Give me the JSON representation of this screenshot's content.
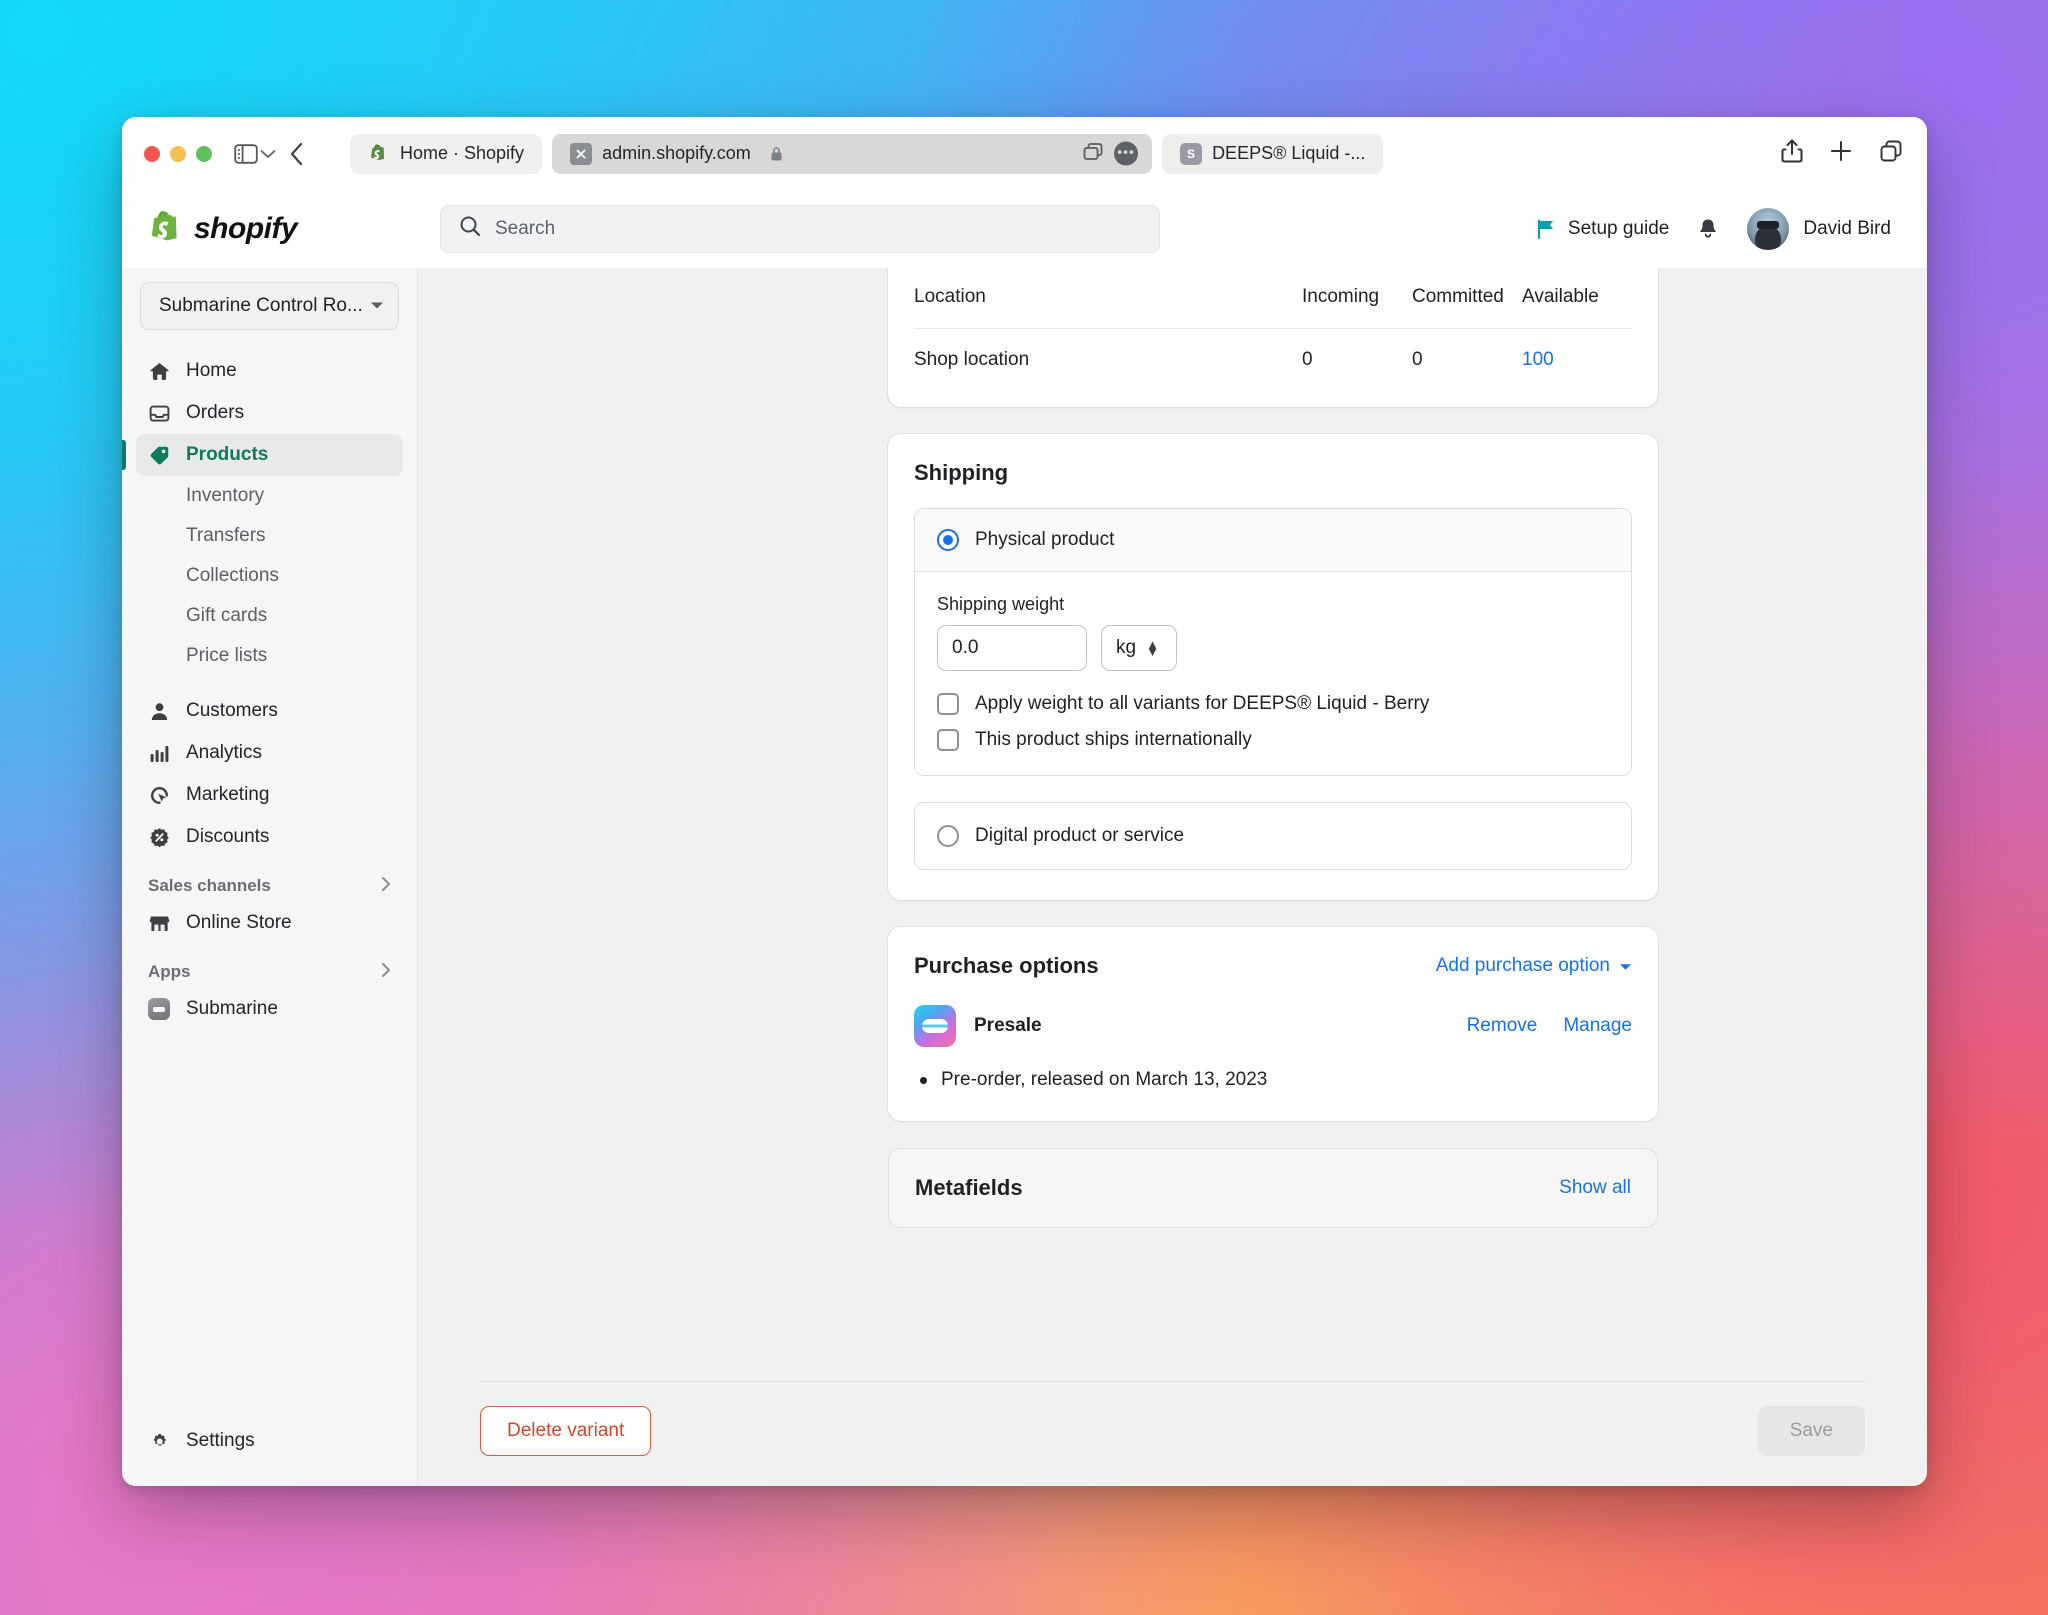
{
  "browser": {
    "tabs": [
      {
        "title": "Home · Shopify",
        "favicon": "shopify-icon",
        "active": false
      },
      {
        "title": "admin.shopify.com",
        "favicon": "x-icon",
        "active": true,
        "lock": "lock-icon"
      },
      {
        "title": "DEEPS® Liquid -...",
        "favicon": "s-icon",
        "active": false
      }
    ],
    "controls": {
      "sidebar_toggle": "sidebar-toggle-icon",
      "tab_overview": "chevron-down-icon",
      "back": "back-arrow-icon",
      "share": "share-icon",
      "new_tab": "plus-icon",
      "tab_group": "copy-icon",
      "tab_copy": "tab-copy-icon",
      "tab_more": "ellipsis-icon"
    }
  },
  "topbar": {
    "brand": "shopify",
    "search": {
      "placeholder": "Search",
      "value": ""
    },
    "setup_guide": "Setup guide",
    "notifications_icon": "bell-icon",
    "user_name": "David Bird"
  },
  "sidebar": {
    "store_selector": "Submarine Control Ro...",
    "items": [
      {
        "label": "Home",
        "icon": "home-icon",
        "active": false
      },
      {
        "label": "Orders",
        "icon": "orders-inbox-icon",
        "active": false
      },
      {
        "label": "Products",
        "icon": "products-tag-icon",
        "active": true
      }
    ],
    "product_subitems": [
      "Inventory",
      "Transfers",
      "Collections",
      "Gift cards",
      "Price lists"
    ],
    "items2": [
      {
        "label": "Customers",
        "icon": "customer-icon"
      },
      {
        "label": "Analytics",
        "icon": "analytics-bars-icon"
      },
      {
        "label": "Marketing",
        "icon": "marketing-target-icon"
      },
      {
        "label": "Discounts",
        "icon": "discount-percent-icon"
      }
    ],
    "sections": [
      {
        "label": "Sales channels",
        "items": [
          {
            "label": "Online Store",
            "icon": "store-icon"
          }
        ]
      },
      {
        "label": "Apps",
        "items": [
          {
            "label": "Submarine",
            "icon": "submarine-app-icon"
          }
        ]
      }
    ],
    "settings": {
      "label": "Settings",
      "icon": "gear-icon"
    }
  },
  "inventory": {
    "columns": [
      "Location",
      "Incoming",
      "Committed",
      "Available"
    ],
    "rows": [
      {
        "location": "Shop location",
        "incoming": "0",
        "committed": "0",
        "available": "100"
      }
    ]
  },
  "shipping": {
    "title": "Shipping",
    "physical_label": "Physical product",
    "physical_selected": true,
    "weight_label": "Shipping weight",
    "weight_value": "0.0",
    "weight_unit": "kg",
    "apply_all_label": "Apply weight to all variants for DEEPS® Liquid - Berry",
    "apply_all_checked": false,
    "international_label": "This product ships internationally",
    "international_checked": false,
    "digital_label": "Digital product or service",
    "digital_selected": false
  },
  "purchase_options": {
    "title": "Purchase options",
    "add_label": "Add purchase option",
    "option_name": "Presale",
    "remove_label": "Remove",
    "manage_label": "Manage",
    "detail": "Pre-order, released on March 13, 2023"
  },
  "metafields": {
    "title": "Metafields",
    "show_all": "Show all"
  },
  "footer": {
    "delete_label": "Delete variant",
    "save_label": "Save"
  },
  "colors": {
    "accent_green": "#0b7c5d",
    "link_blue": "#1a71e8",
    "danger_red": "#d8452a",
    "teal_flag": "#00a0ac"
  }
}
